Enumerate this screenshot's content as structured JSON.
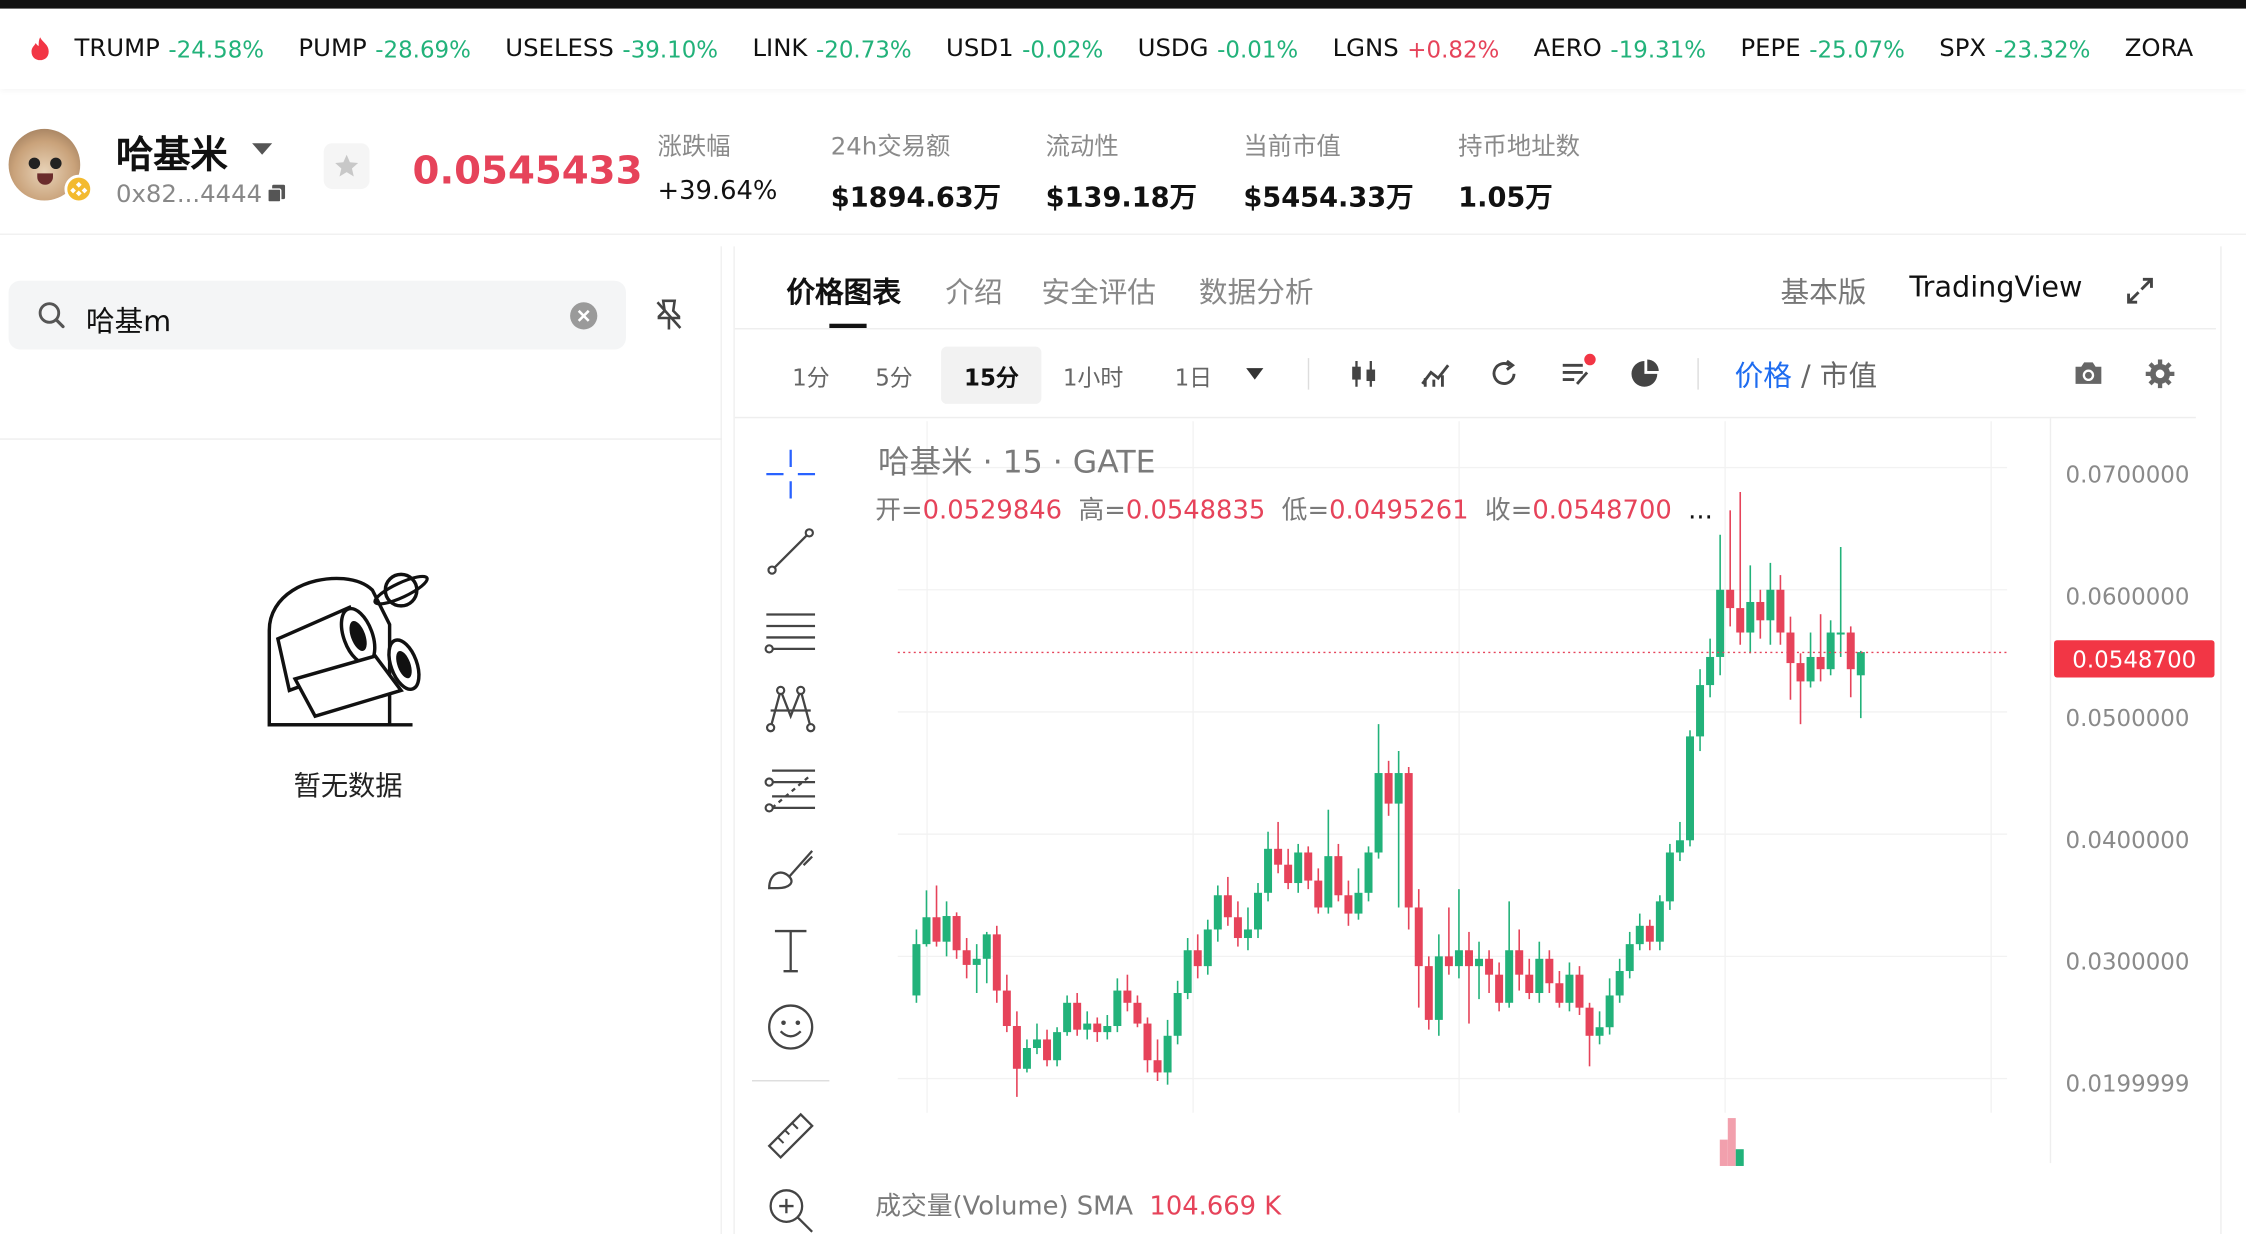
{
  "ticker": [
    {
      "symbol": "TRUMP",
      "change": "-24.58%",
      "dir": "neg"
    },
    {
      "symbol": "PUMP",
      "change": "-28.69%",
      "dir": "neg"
    },
    {
      "symbol": "USELESS",
      "change": "-39.10%",
      "dir": "neg"
    },
    {
      "symbol": "LINK",
      "change": "-20.73%",
      "dir": "neg"
    },
    {
      "symbol": "USD1",
      "change": "-0.02%",
      "dir": "neg"
    },
    {
      "symbol": "USDG",
      "change": "-0.01%",
      "dir": "neg"
    },
    {
      "symbol": "LGNS",
      "change": "+0.82%",
      "dir": "pos"
    },
    {
      "symbol": "AERO",
      "change": "-19.31%",
      "dir": "neg"
    },
    {
      "symbol": "PEPE",
      "change": "-25.07%",
      "dir": "neg"
    },
    {
      "symbol": "SPX",
      "change": "-23.32%",
      "dir": "neg"
    },
    {
      "symbol": "ZORA",
      "change": "",
      "dir": "neg"
    }
  ],
  "token": {
    "name": "哈基米",
    "address": "0x82...4444",
    "price": "0.0545433"
  },
  "stats": [
    {
      "label": "涨跌幅",
      "value": "+39.64%",
      "color": "pos"
    },
    {
      "label": "24h交易额",
      "value": "$1894.63万",
      "color": ""
    },
    {
      "label": "流动性",
      "value": "$139.18万",
      "color": ""
    },
    {
      "label": "当前市值",
      "value": "$5454.33万",
      "color": ""
    },
    {
      "label": "持币地址数",
      "value": "1.05万",
      "color": ""
    }
  ],
  "search": {
    "value": "哈基m"
  },
  "empty_text": "暂无数据",
  "tabs": [
    "价格图表",
    "介绍",
    "安全评估",
    "数据分析"
  ],
  "versions": {
    "basic": "基本版",
    "tradingview": "TradingView"
  },
  "intervals": [
    "1分",
    "5分",
    "15分",
    "1小时",
    "1日"
  ],
  "selected_interval": "15分",
  "price_mode": {
    "price": "价格",
    "sep": " / ",
    "mcap": "市值"
  },
  "legend": {
    "title": "哈基米 · 15 · GATE",
    "o_label": "开=",
    "o": "0.0529846",
    "h_label": "高=",
    "h": "0.0548835",
    "l_label": "低=",
    "l": "0.0495261",
    "c_label": "收=",
    "c": "0.0548700",
    "more": "..."
  },
  "volume": {
    "label": "成交量(Volume) SMA",
    "value": "104.669 K"
  },
  "axis_ticks": [
    "0.0700000",
    "0.0600000",
    "0.0500000",
    "0.0400000",
    "0.0300000",
    "0.0199999"
  ],
  "current_price_label": "0.0548700",
  "colors": {
    "up": "#22b27a",
    "down": "#e6435a",
    "accent": "#1e6cf0"
  },
  "chart_data": {
    "type": "candlestick",
    "title": "哈基米 · 15 · GATE",
    "ylim": [
      0.0172,
      0.0738
    ],
    "candles": [
      [
        0.0268,
        0.031,
        0.0322,
        0.0262
      ],
      [
        0.031,
        0.0332,
        0.0354,
        0.0308
      ],
      [
        0.0332,
        0.0312,
        0.0358,
        0.0308
      ],
      [
        0.0312,
        0.0333,
        0.0345,
        0.03
      ],
      [
        0.0333,
        0.0305,
        0.0336,
        0.0298
      ],
      [
        0.0305,
        0.0293,
        0.0315,
        0.0282
      ],
      [
        0.0293,
        0.0298,
        0.031,
        0.027
      ],
      [
        0.0298,
        0.0318,
        0.032,
        0.0278
      ],
      [
        0.0318,
        0.0272,
        0.0325,
        0.0262
      ],
      [
        0.0272,
        0.0243,
        0.0285,
        0.0238
      ],
      [
        0.0243,
        0.0208,
        0.0255,
        0.0185
      ],
      [
        0.0208,
        0.0225,
        0.0232,
        0.0205
      ],
      [
        0.0225,
        0.0232,
        0.0245,
        0.022
      ],
      [
        0.0232,
        0.0215,
        0.024,
        0.021
      ],
      [
        0.0215,
        0.0238,
        0.0242,
        0.021
      ],
      [
        0.0238,
        0.0262,
        0.0268,
        0.0235
      ],
      [
        0.0262,
        0.024,
        0.027,
        0.0235
      ],
      [
        0.024,
        0.0245,
        0.0255,
        0.0232
      ],
      [
        0.0245,
        0.0238,
        0.025,
        0.023
      ],
      [
        0.0238,
        0.0243,
        0.0252,
        0.0232
      ],
      [
        0.0243,
        0.0272,
        0.0282,
        0.0238
      ],
      [
        0.0272,
        0.0262,
        0.0285,
        0.0255
      ],
      [
        0.0262,
        0.0245,
        0.0268,
        0.0242
      ],
      [
        0.0245,
        0.0215,
        0.025,
        0.0205
      ],
      [
        0.0215,
        0.0205,
        0.0232,
        0.0198
      ],
      [
        0.0205,
        0.0235,
        0.0248,
        0.0195
      ],
      [
        0.0235,
        0.027,
        0.028,
        0.0228
      ],
      [
        0.027,
        0.0305,
        0.0315,
        0.0265
      ],
      [
        0.0305,
        0.0292,
        0.0318,
        0.0282
      ],
      [
        0.0292,
        0.0322,
        0.033,
        0.0285
      ],
      [
        0.0322,
        0.035,
        0.0358,
        0.0312
      ],
      [
        0.035,
        0.0332,
        0.0365,
        0.0325
      ],
      [
        0.0332,
        0.0315,
        0.0345,
        0.0308
      ],
      [
        0.0315,
        0.0322,
        0.034,
        0.0305
      ],
      [
        0.0322,
        0.0352,
        0.036,
        0.0315
      ],
      [
        0.0352,
        0.0388,
        0.0402,
        0.0345
      ],
      [
        0.0388,
        0.0375,
        0.041,
        0.0368
      ],
      [
        0.0375,
        0.036,
        0.0388,
        0.0355
      ],
      [
        0.036,
        0.0385,
        0.0392,
        0.0352
      ],
      [
        0.0385,
        0.0362,
        0.039,
        0.0355
      ],
      [
        0.0362,
        0.034,
        0.0372,
        0.0335
      ],
      [
        0.034,
        0.0382,
        0.042,
        0.0335
      ],
      [
        0.0382,
        0.035,
        0.0392,
        0.0345
      ],
      [
        0.035,
        0.0335,
        0.0362,
        0.0325
      ],
      [
        0.0335,
        0.0352,
        0.0372,
        0.033
      ],
      [
        0.0352,
        0.0385,
        0.039,
        0.0345
      ],
      [
        0.0385,
        0.045,
        0.049,
        0.038
      ],
      [
        0.045,
        0.0425,
        0.046,
        0.0415
      ],
      [
        0.0425,
        0.045,
        0.0468,
        0.034
      ],
      [
        0.045,
        0.034,
        0.0455,
        0.0322
      ],
      [
        0.034,
        0.0292,
        0.0355,
        0.0258
      ],
      [
        0.0292,
        0.0248,
        0.03,
        0.024
      ],
      [
        0.0248,
        0.03,
        0.0318,
        0.0235
      ],
      [
        0.03,
        0.0292,
        0.034,
        0.0285
      ],
      [
        0.0292,
        0.0305,
        0.0355,
        0.0282
      ],
      [
        0.0305,
        0.0292,
        0.032,
        0.0245
      ],
      [
        0.0292,
        0.0298,
        0.0312,
        0.0265
      ],
      [
        0.0298,
        0.0285,
        0.0305,
        0.027
      ],
      [
        0.0285,
        0.0262,
        0.0295,
        0.0255
      ],
      [
        0.0262,
        0.0305,
        0.0345,
        0.0258
      ],
      [
        0.0305,
        0.0285,
        0.0322,
        0.0272
      ],
      [
        0.0285,
        0.027,
        0.0298,
        0.0265
      ],
      [
        0.027,
        0.0298,
        0.0312,
        0.0262
      ],
      [
        0.0298,
        0.0278,
        0.0305,
        0.027
      ],
      [
        0.0278,
        0.0262,
        0.0288,
        0.0258
      ],
      [
        0.0262,
        0.0285,
        0.0295,
        0.0255
      ],
      [
        0.0285,
        0.0258,
        0.0292,
        0.0252
      ],
      [
        0.0258,
        0.0235,
        0.0262,
        0.021
      ],
      [
        0.0235,
        0.0242,
        0.0255,
        0.0228
      ],
      [
        0.0242,
        0.0268,
        0.0282,
        0.0236
      ],
      [
        0.0268,
        0.0288,
        0.0298,
        0.0262
      ],
      [
        0.0288,
        0.031,
        0.032,
        0.0282
      ],
      [
        0.031,
        0.0325,
        0.0335,
        0.0305
      ],
      [
        0.0325,
        0.0312,
        0.033,
        0.0305
      ],
      [
        0.0312,
        0.0345,
        0.035,
        0.0305
      ],
      [
        0.0345,
        0.0385,
        0.0392,
        0.0338
      ],
      [
        0.0385,
        0.0395,
        0.041,
        0.0378
      ],
      [
        0.0395,
        0.048,
        0.0485,
        0.039
      ],
      [
        0.048,
        0.0522,
        0.0535,
        0.0468
      ],
      [
        0.0522,
        0.0545,
        0.056,
        0.0512
      ],
      [
        0.0545,
        0.06,
        0.0645,
        0.053
      ],
      [
        0.06,
        0.0585,
        0.0665,
        0.057
      ],
      [
        0.0585,
        0.0565,
        0.068,
        0.0555
      ],
      [
        0.0565,
        0.059,
        0.062,
        0.0548
      ],
      [
        0.059,
        0.0575,
        0.06,
        0.056
      ],
      [
        0.0575,
        0.06,
        0.0622,
        0.0555
      ],
      [
        0.06,
        0.0565,
        0.0612,
        0.0555
      ],
      [
        0.0565,
        0.054,
        0.0578,
        0.051
      ],
      [
        0.054,
        0.0525,
        0.0548,
        0.049
      ],
      [
        0.0525,
        0.0545,
        0.0565,
        0.052
      ],
      [
        0.0545,
        0.0535,
        0.058,
        0.0525
      ],
      [
        0.0535,
        0.0565,
        0.0575,
        0.053
      ],
      [
        0.0565,
        0.0565,
        0.0635,
        0.0545
      ],
      [
        0.0565,
        0.0535,
        0.057,
        0.0512
      ],
      [
        0.053,
        0.0549,
        0.055,
        0.0495
      ]
    ],
    "volume_bars": [
      {
        "value": 0.55,
        "dir": "down"
      },
      {
        "value": 1.0,
        "dir": "down"
      },
      {
        "value": 0.35,
        "dir": "up"
      }
    ]
  }
}
